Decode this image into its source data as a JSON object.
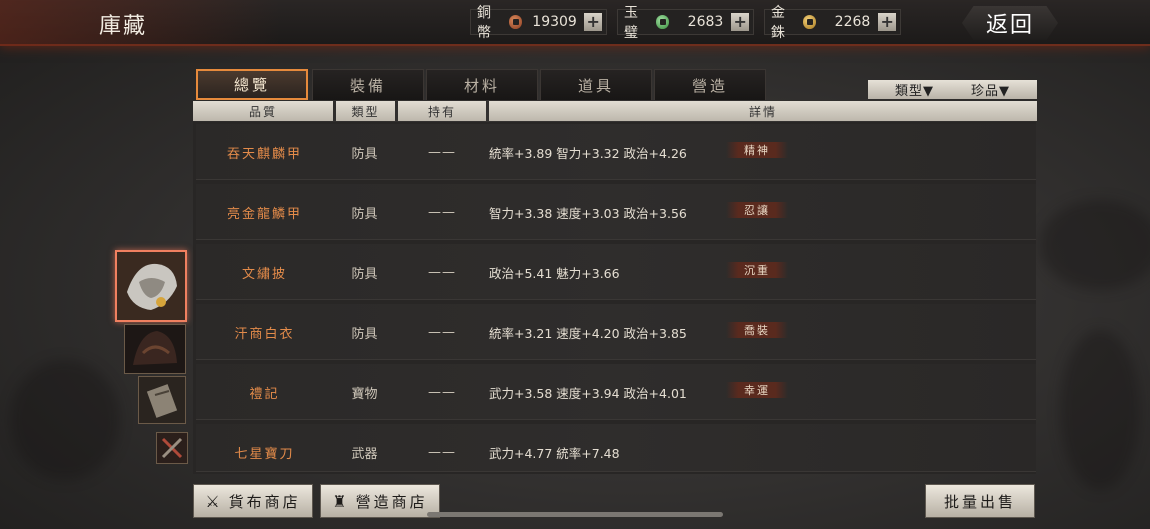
{
  "header": {
    "title": "庫藏",
    "back_label": "返回"
  },
  "currencies": [
    {
      "name": "銅幣",
      "amount": "19309",
      "icon": "copper-coin-icon",
      "color": "#b05a34"
    },
    {
      "name": "玉璧",
      "amount": "2683",
      "icon": "jade-coin-icon",
      "color": "#5fb863"
    },
    {
      "name": "金銖",
      "amount": "2268",
      "icon": "gold-coin-icon",
      "color": "#d6a43b"
    }
  ],
  "tabs": [
    {
      "label": "總覽",
      "active": true
    },
    {
      "label": "裝備",
      "active": false
    },
    {
      "label": "材料",
      "active": false
    },
    {
      "label": "道具",
      "active": false
    },
    {
      "label": "營造",
      "active": false
    }
  ],
  "filters": {
    "type_label": "類型▼",
    "rarity_label": "珍品▼"
  },
  "columns": [
    "品質",
    "類型",
    "持有",
    "詳情"
  ],
  "rows": [
    {
      "name": "吞天麒麟甲",
      "type": "防具",
      "held": "——",
      "detail": "統率+3.89 智力+3.32 政治+4.26",
      "tag": "精神"
    },
    {
      "name": "亮金龍鱗甲",
      "type": "防具",
      "held": "——",
      "detail": "智力+3.38 速度+3.03 政治+3.56",
      "tag": "忍讓"
    },
    {
      "name": "文繡披",
      "type": "防具",
      "held": "——",
      "detail": "政治+5.41 魅力+3.66",
      "tag": "沉重"
    },
    {
      "name": "汗商白衣",
      "type": "防具",
      "held": "——",
      "detail": "統率+3.21 速度+4.20 政治+3.85",
      "tag": "喬裝"
    },
    {
      "name": "禮記",
      "type": "寶物",
      "held": "——",
      "detail": "武力+3.58 速度+3.94 政治+4.01",
      "tag": "幸運"
    },
    {
      "name": "七星寶刀",
      "type": "武器",
      "held": "——",
      "detail": "武力+4.77 統率+7.48",
      "tag": ""
    }
  ],
  "footer": {
    "currency_shop_label": "貨布商店",
    "build_shop_label": "營造商店",
    "bulk_sell_label": "批量出售"
  },
  "colors": {
    "accent": "#e68a3c",
    "item_name": "#e38b4a",
    "tag_bg": "#5a2a1e"
  }
}
